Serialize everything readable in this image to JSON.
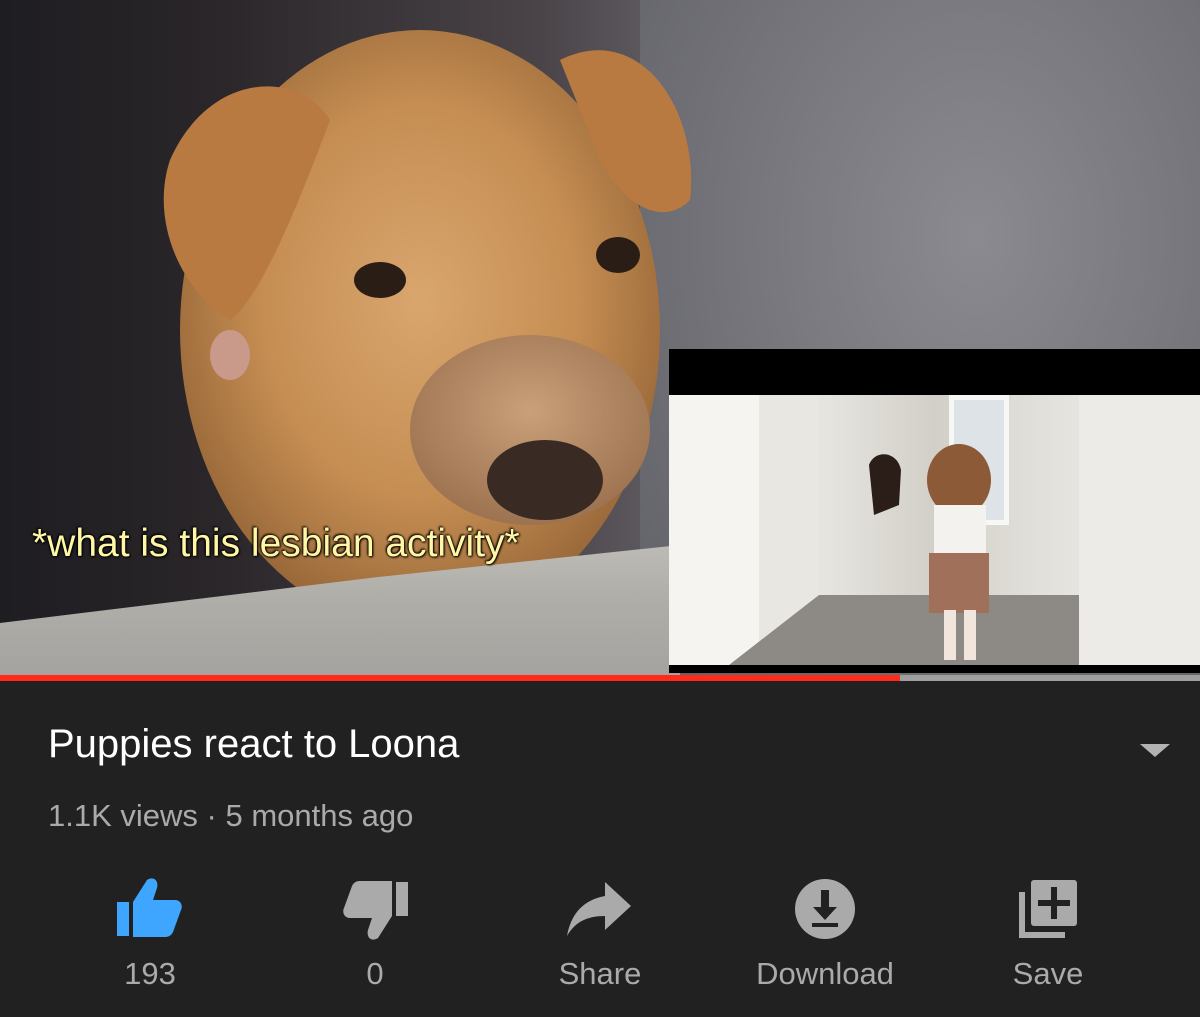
{
  "video": {
    "caption": "*what is this lesbian activity*",
    "progress_fraction": 0.75
  },
  "info": {
    "title": "Puppies react to Loona",
    "views": "1.1K views",
    "separator": " · ",
    "age": "5 months ago"
  },
  "actions": [
    {
      "icon": "thumbs-up-icon",
      "label": "193",
      "color": "#3ea6ff"
    },
    {
      "icon": "thumbs-down-icon",
      "label": "0",
      "color": "#aaaaaa"
    },
    {
      "icon": "share-icon",
      "label": "Share",
      "color": "#aaaaaa"
    },
    {
      "icon": "download-icon",
      "label": "Download",
      "color": "#aaaaaa"
    },
    {
      "icon": "add-to-playlist-icon",
      "label": "Save",
      "color": "#aaaaaa"
    }
  ],
  "colors": {
    "background": "#212121",
    "progress": "#ff2a1a",
    "accent": "#3ea6ff"
  }
}
